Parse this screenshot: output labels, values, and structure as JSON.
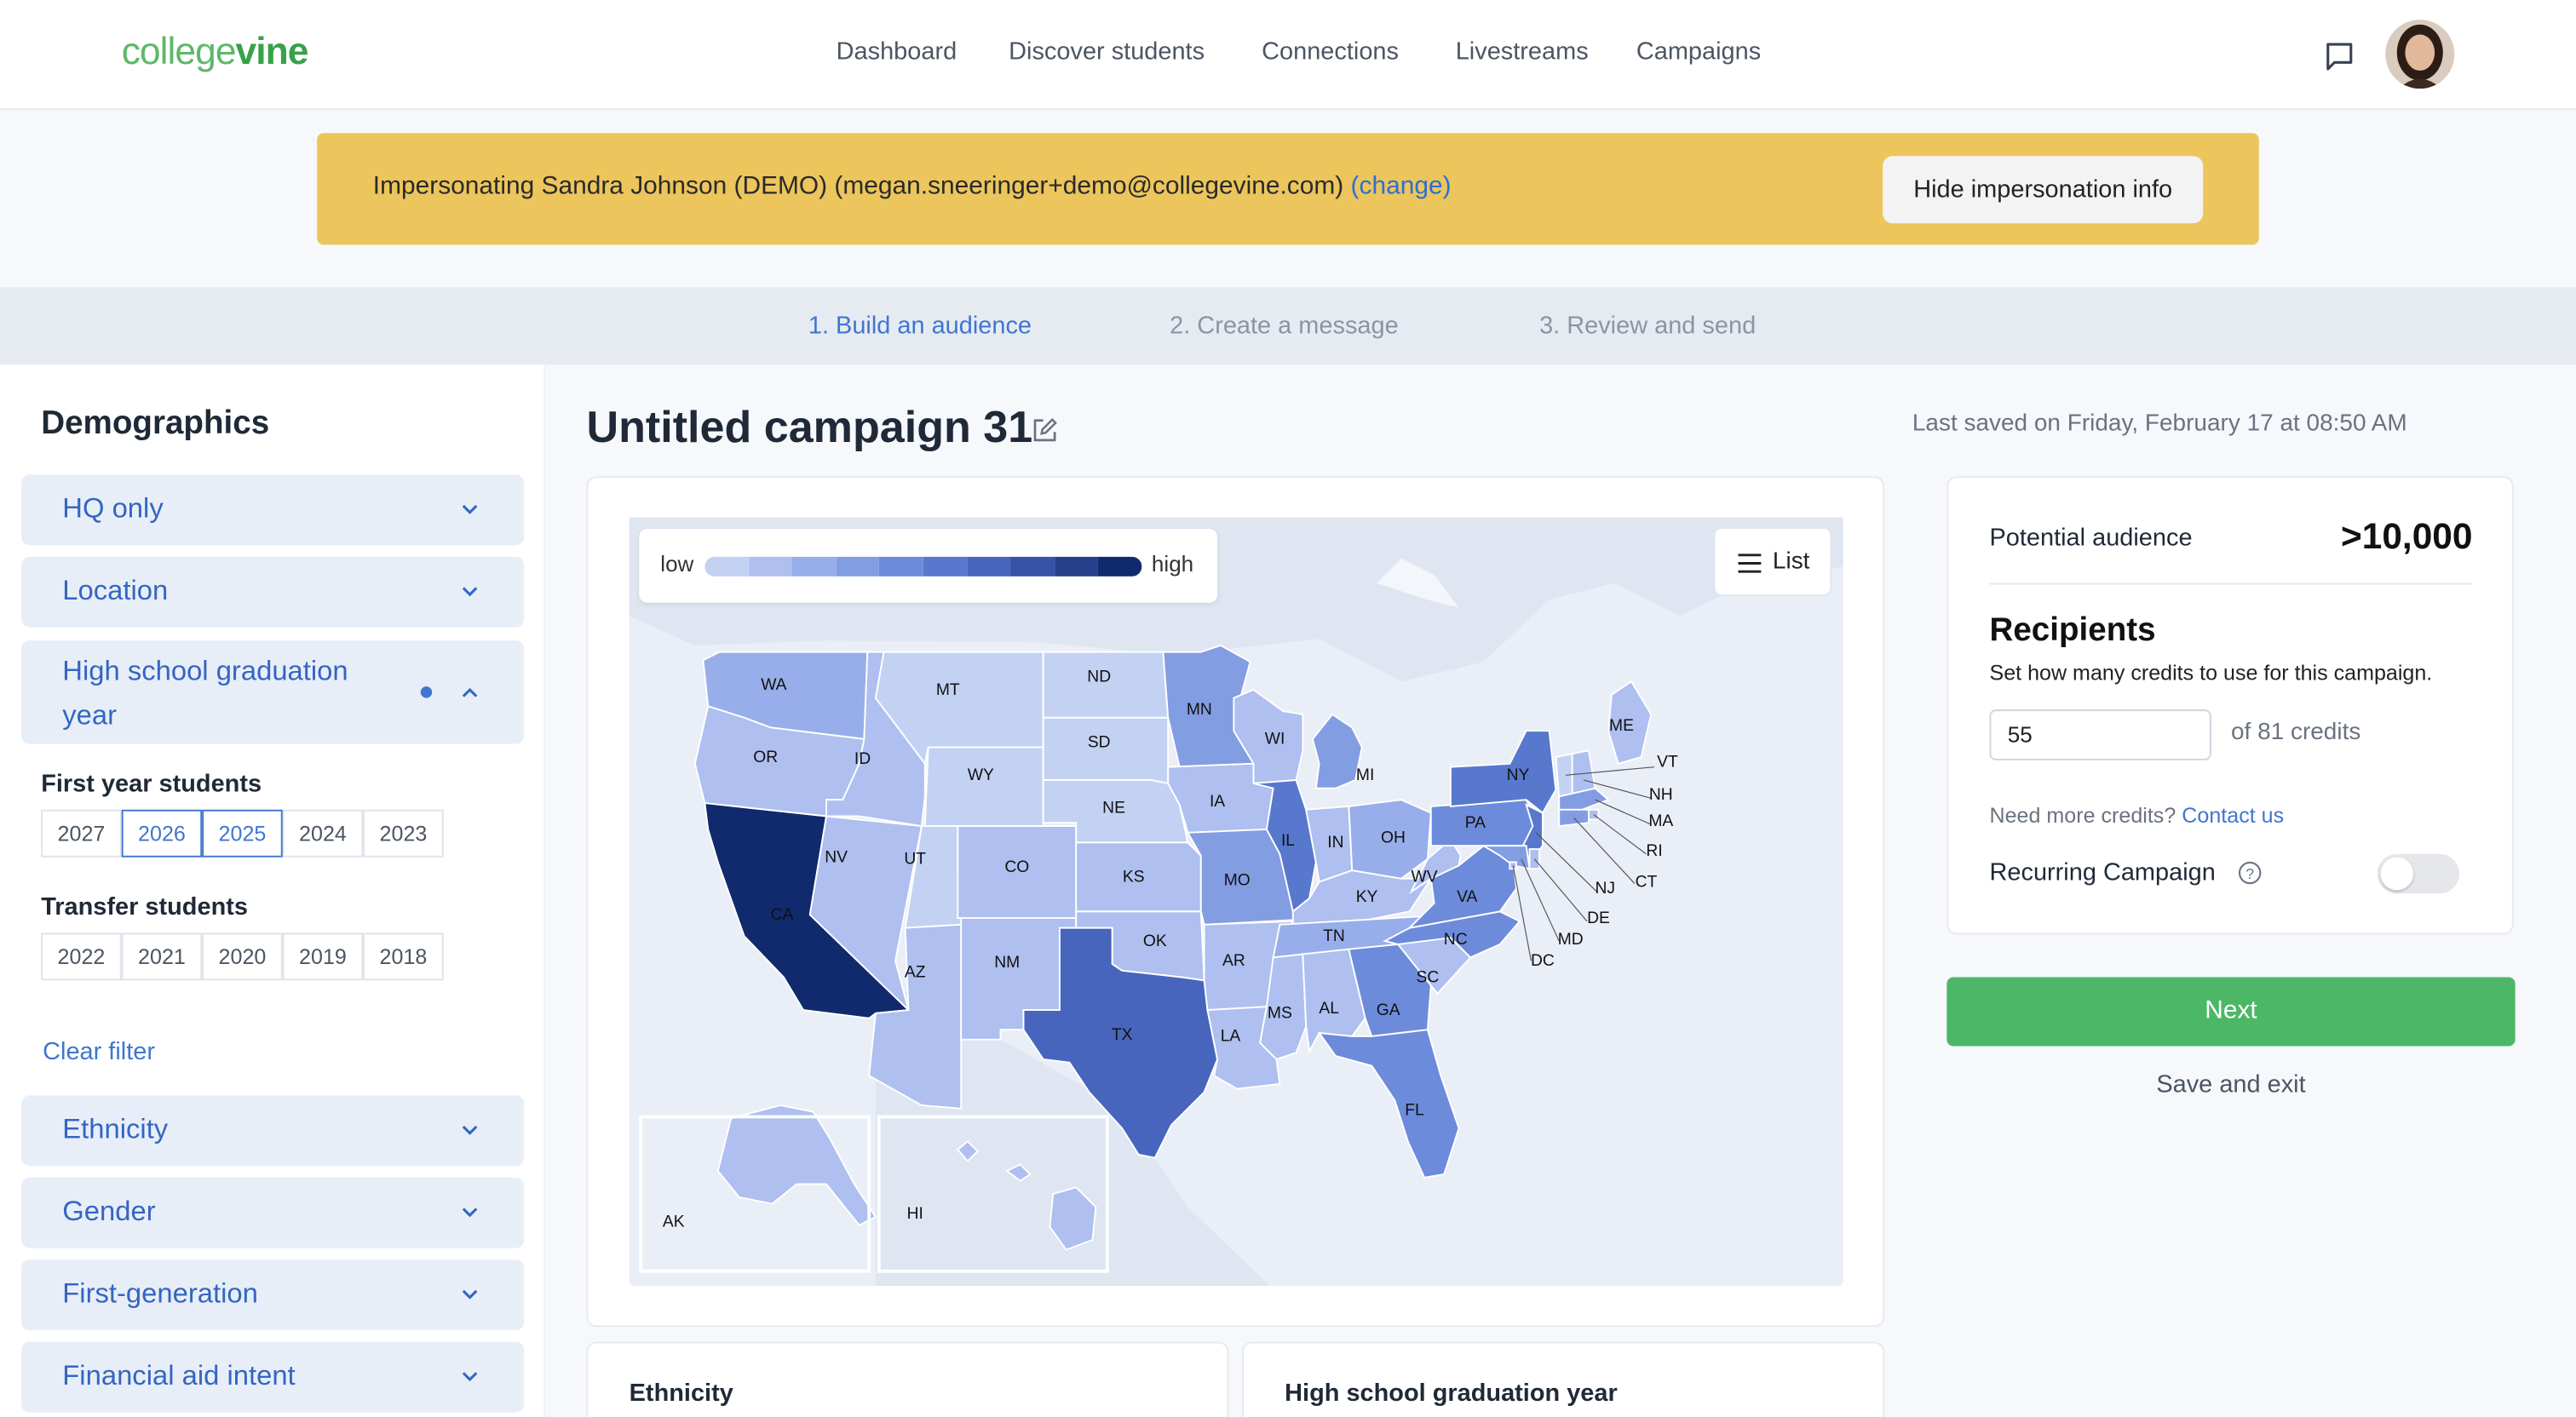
{
  "header": {
    "logo_part1": "college",
    "logo_part2": "vine",
    "nav": [
      "Dashboard",
      "Discover students",
      "Connections",
      "Livestreams",
      "Campaigns"
    ]
  },
  "banner": {
    "text": "Impersonating Sandra Johnson (DEMO) (megan.sneeringer+demo@collegevine.com)",
    "change": "(change)",
    "button": "Hide impersonation info"
  },
  "steps": [
    "1. Build an audience",
    "2. Create a message",
    "3. Review and send"
  ],
  "sidebar": {
    "title": "Demographics",
    "sections_top": [
      "HQ only",
      "Location"
    ],
    "grad_section": {
      "label": "High school graduation year",
      "first_year_title": "First year students",
      "first_year": [
        "2027",
        "2026",
        "2025",
        "2024",
        "2023"
      ],
      "first_year_selected": [
        "2026",
        "2025"
      ],
      "transfer_title": "Transfer students",
      "transfer": [
        "2022",
        "2021",
        "2020",
        "2019",
        "2018"
      ]
    },
    "clear_filter": "Clear filter",
    "sections_bottom": [
      "Ethnicity",
      "Gender",
      "First-generation",
      "Financial aid intent"
    ]
  },
  "main": {
    "title": "Untitled campaign 31",
    "saved": "Last saved on Friday, February 17 at 08:50 AM",
    "legend_low": "low",
    "legend_high": "high",
    "list_button": "List",
    "bottom_cards": [
      "Ethnicity",
      "High school graduation year"
    ]
  },
  "legend_colors": [
    "#c3d2f3",
    "#aebff0",
    "#98aeea",
    "#839de3",
    "#6d8bdb",
    "#5878cd",
    "#4865bd",
    "#3752a6",
    "#26408c",
    "#112a6e"
  ],
  "map_states": [
    {
      "code": "WA",
      "level": 2
    },
    {
      "code": "OR",
      "level": 1
    },
    {
      "code": "CA",
      "level": 9
    },
    {
      "code": "ID",
      "level": 1
    },
    {
      "code": "NV",
      "level": 1
    },
    {
      "code": "MT",
      "level": 0
    },
    {
      "code": "WY",
      "level": 0
    },
    {
      "code": "UT",
      "level": 0
    },
    {
      "code": "CO",
      "level": 1
    },
    {
      "code": "AZ",
      "level": 1
    },
    {
      "code": "NM",
      "level": 1
    },
    {
      "code": "ND",
      "level": 0
    },
    {
      "code": "SD",
      "level": 0
    },
    {
      "code": "NE",
      "level": 0
    },
    {
      "code": "KS",
      "level": 1
    },
    {
      "code": "OK",
      "level": 1
    },
    {
      "code": "TX",
      "level": 6
    },
    {
      "code": "MN",
      "level": 3
    },
    {
      "code": "IA",
      "level": 1
    },
    {
      "code": "MO",
      "level": 3
    },
    {
      "code": "AR",
      "level": 1
    },
    {
      "code": "LA",
      "level": 1
    },
    {
      "code": "WI",
      "level": 1
    },
    {
      "code": "IL",
      "level": 5
    },
    {
      "code": "MI",
      "level": 3
    },
    {
      "code": "IN",
      "level": 1
    },
    {
      "code": "OH",
      "level": 2
    },
    {
      "code": "KY",
      "level": 1
    },
    {
      "code": "TN",
      "level": 2
    },
    {
      "code": "MS",
      "level": 1
    },
    {
      "code": "AL",
      "level": 1
    },
    {
      "code": "GA",
      "level": 4
    },
    {
      "code": "FL",
      "level": 4
    },
    {
      "code": "SC",
      "level": 1
    },
    {
      "code": "NC",
      "level": 4
    },
    {
      "code": "VA",
      "level": 4
    },
    {
      "code": "WV",
      "level": 1
    },
    {
      "code": "PA",
      "level": 4
    },
    {
      "code": "NY",
      "level": 5
    },
    {
      "code": "ME",
      "level": 1
    },
    {
      "code": "NJ",
      "level": 5
    },
    {
      "code": "AK",
      "level": 1
    },
    {
      "code": "HI",
      "level": 1
    },
    {
      "code": "VT",
      "level": 0
    },
    {
      "code": "NH",
      "level": 1
    },
    {
      "code": "MA",
      "level": 3
    },
    {
      "code": "RI",
      "level": 1
    },
    {
      "code": "CT",
      "level": 3
    },
    {
      "code": "DE",
      "level": 1
    },
    {
      "code": "MD",
      "level": 3
    },
    {
      "code": "DC",
      "level": 1
    }
  ],
  "right_panel": {
    "potential_label": "Potential audience",
    "potential_value": ">10,000",
    "recipients_title": "Recipients",
    "recipients_sub": "Set how many credits to use for this campaign.",
    "credits_value": "55",
    "of_credits": "of 81 credits",
    "need_more": "Need more credits?",
    "contact": "Contact us",
    "recurring": "Recurring Campaign",
    "recurring_on": false,
    "next": "Next",
    "save_exit": "Save and exit"
  }
}
